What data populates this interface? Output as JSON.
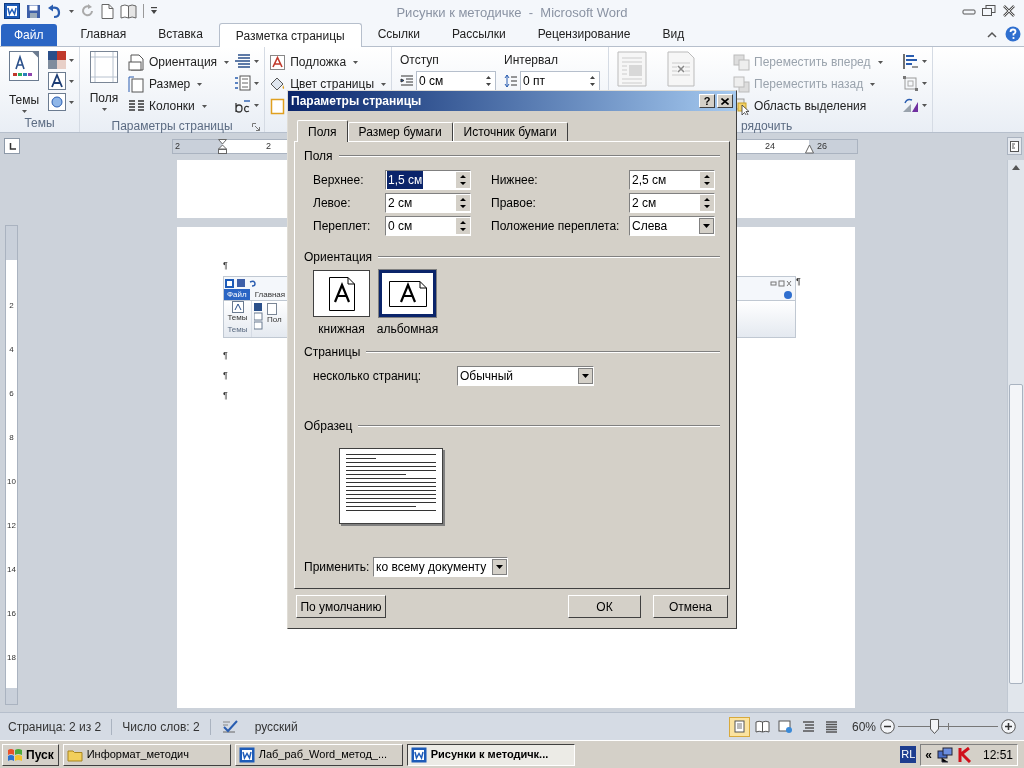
{
  "title_bar": {
    "title": "Рисунки к методичке  -  Microsoft Word"
  },
  "ribbon_tabs": [
    {
      "label": "Файл",
      "kind": "file",
      "selected": false
    },
    {
      "label": "Главная",
      "kind": "tab",
      "selected": false
    },
    {
      "label": "Вставка",
      "kind": "tab",
      "selected": false
    },
    {
      "label": "Разметка страницы",
      "kind": "tab",
      "selected": true
    },
    {
      "label": "Ссылки",
      "kind": "tab",
      "selected": false
    },
    {
      "label": "Рассылки",
      "kind": "tab",
      "selected": false
    },
    {
      "label": "Рецензирование",
      "kind": "tab",
      "selected": false
    },
    {
      "label": "Вид",
      "kind": "tab",
      "selected": false
    }
  ],
  "themes_group": {
    "label": "Темы",
    "button": "Темы"
  },
  "page_setup_group": {
    "label": "Параметры страницы",
    "large_button": "Поля",
    "commands": [
      "Ориентация",
      "Размер",
      "Колонки"
    ]
  },
  "page_background_group": {
    "commands": [
      "Подложка",
      "Цвет страницы"
    ]
  },
  "paragraph_group": {
    "indent": {
      "label": "Отступ",
      "value": "0 см"
    },
    "spacing": {
      "label": "Интервал",
      "value": "0 пт"
    }
  },
  "arrange_group": {
    "label": "рядочить",
    "commands": [
      {
        "label": "Переместить вперед",
        "disabled": true
      },
      {
        "label": "Переместить назад",
        "disabled": true
      },
      {
        "label": "Область выделения",
        "disabled": false
      }
    ]
  },
  "horizontal_ruler": {
    "numbers": [
      "2",
      "2",
      "24",
      "26"
    ]
  },
  "vertical_ruler": {
    "numbers": [
      "2",
      "4",
      "6",
      "8",
      "10",
      "12",
      "14",
      "16",
      "18"
    ]
  },
  "document": {
    "marks_before": [
      "¶"
    ],
    "embedded_screenshot": {
      "tabs": [
        "Файл",
        "Главная"
      ],
      "button": "Темы",
      "group": "Темы",
      "cut_label": "Пол"
    },
    "mark_after_image": "¶",
    "marks_after": [
      "¶",
      "¶",
      "¶"
    ]
  },
  "dialog": {
    "title": "Параметры страницы",
    "help": "?",
    "tabs": [
      {
        "label": "Поля",
        "selected": true
      },
      {
        "label": "Размер бумаги",
        "selected": false
      },
      {
        "label": "Источник бумаги",
        "selected": false
      }
    ],
    "margins_header": "Поля",
    "margins": [
      {
        "label": "Верхнее:",
        "value": "1,5 см",
        "highlighted": true
      },
      {
        "label": "Нижнее:",
        "value": "2,5 см",
        "highlighted": false
      },
      {
        "label": "Левое:",
        "value": "2 см",
        "highlighted": false
      },
      {
        "label": "Правое:",
        "value": "2 см",
        "highlighted": false
      },
      {
        "label": "Переплет:",
        "value": "0 см",
        "highlighted": false
      }
    ],
    "gutter_position": {
      "label": "Положение переплета:",
      "value": "Слева"
    },
    "orientation_header": "Ориентация",
    "orientations": [
      {
        "label": "книжная",
        "kind": "portrait",
        "selected": false
      },
      {
        "label": "альбомная",
        "kind": "landscape",
        "selected": true
      }
    ],
    "pages_header": "Страницы",
    "multiple_pages": {
      "label": "несколько страниц:",
      "value": "Обычный"
    },
    "preview_header": "Образец",
    "apply": {
      "label": "Применить:",
      "value": "ко всему документу"
    },
    "buttons": [
      "По умолчанию",
      "ОК",
      "Отмена"
    ]
  },
  "status_bar": {
    "page": "Страница: 2 из 2",
    "words": "Число слов: 2",
    "language": "русский",
    "views": [
      {
        "selected": true
      },
      {
        "selected": false
      },
      {
        "selected": false
      },
      {
        "selected": false
      },
      {
        "selected": false
      }
    ],
    "zoom": "60%",
    "zoom_level": {
      "level": 0.36
    }
  },
  "taskbar": {
    "start": "Пуск",
    "tasks": [
      {
        "label": "Информат_методич",
        "kind": "folder",
        "selected": false
      },
      {
        "label": "Лаб_раб_Word_метод_...",
        "kind": "word",
        "selected": false
      },
      {
        "label": "Рисунки к методичк...",
        "kind": "word",
        "selected": true
      }
    ],
    "language": "RL",
    "expand": "«",
    "clock": "12:51"
  }
}
